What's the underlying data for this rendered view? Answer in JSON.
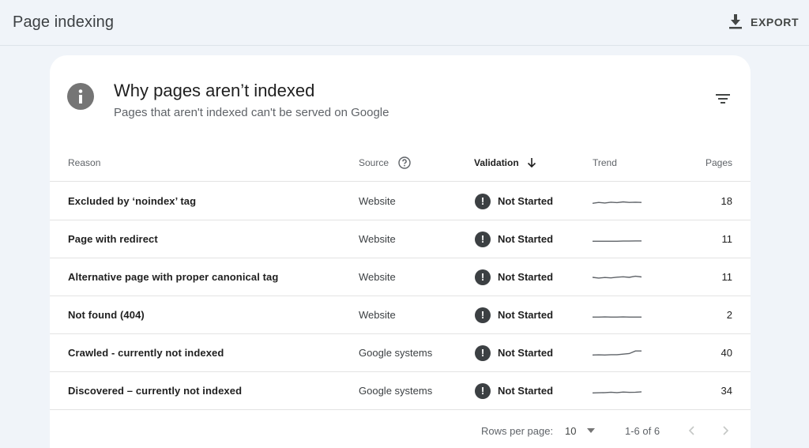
{
  "header": {
    "title": "Page indexing",
    "export_label": "EXPORT"
  },
  "card": {
    "title": "Why pages aren’t indexed",
    "subtitle": "Pages that aren't indexed can't be served on Google"
  },
  "table": {
    "columns": {
      "reason": "Reason",
      "source": "Source",
      "validation": "Validation",
      "trend": "Trend",
      "pages": "Pages"
    },
    "rows": [
      {
        "reason": "Excluded by ‘noindex’ tag",
        "source": "Website",
        "validation": "Not Started",
        "pages": "18",
        "trend": [
          2,
          2.5,
          2.2,
          2.6,
          2.4,
          2.8,
          2.5,
          2.6,
          2.5
        ]
      },
      {
        "reason": "Page with redirect",
        "source": "Website",
        "validation": "Not Started",
        "pages": "11",
        "trend": [
          2,
          2,
          2,
          2,
          2,
          2.1,
          2.1,
          2.2,
          2.2
        ]
      },
      {
        "reason": "Alternative page with proper canonical tag",
        "source": "Website",
        "validation": "Not Started",
        "pages": "11",
        "trend": [
          3,
          2.6,
          2.9,
          2.7,
          3.1,
          3.3,
          3.0,
          3.6,
          3.2
        ]
      },
      {
        "reason": "Not found (404)",
        "source": "Website",
        "validation": "Not Started",
        "pages": "2",
        "trend": [
          2,
          2,
          2.1,
          2,
          2,
          2.1,
          2,
          2,
          2
        ]
      },
      {
        "reason": "Crawled - currently not indexed",
        "source": "Google systems",
        "validation": "Not Started",
        "pages": "40",
        "trend": [
          2,
          2.1,
          2.0,
          2.2,
          2.2,
          2.5,
          2.8,
          4.2,
          4.2
        ]
      },
      {
        "reason": "Discovered – currently not indexed",
        "source": "Google systems",
        "validation": "Not Started",
        "pages": "34",
        "trend": [
          2,
          2.1,
          2.2,
          2.4,
          2.2,
          2.5,
          2.3,
          2.4,
          2.6
        ]
      }
    ]
  },
  "pagination": {
    "rows_per_page_label": "Rows per page:",
    "rows_per_page_value": "10",
    "range_label": "1-6 of 6"
  },
  "colors": {
    "background": "#f0f4f9",
    "card": "#ffffff",
    "status_icon": "#3c4043",
    "sparkline": "#5f6368"
  },
  "icons": {
    "export": "download-icon",
    "info": "info-icon",
    "filter": "filter-icon",
    "source_help": "help-circle-icon",
    "sort": "arrow-down-icon",
    "status": "exclamation-icon"
  }
}
